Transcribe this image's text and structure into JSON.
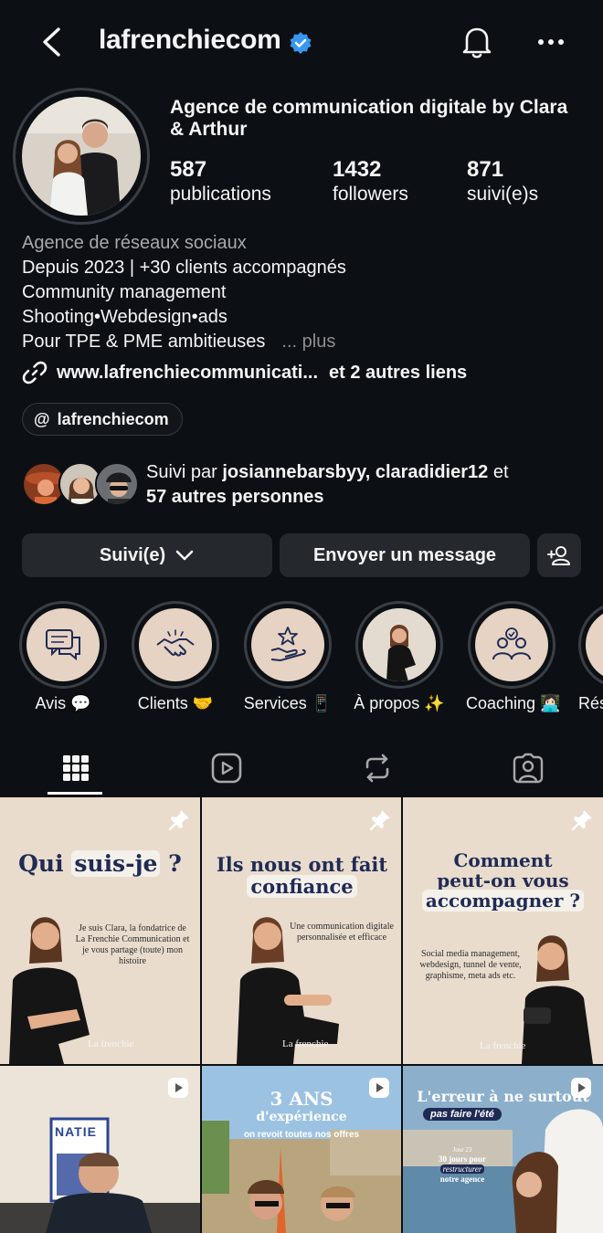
{
  "header": {
    "username": "lafrenchiecom",
    "verified": true,
    "icons": [
      "back-arrow-icon",
      "verified-badge-icon",
      "bell-icon",
      "more-dots-icon"
    ]
  },
  "profile": {
    "full_name": "Agence de communication digitale by Clara & Arthur",
    "stats": [
      {
        "value": "587",
        "label": "publications"
      },
      {
        "value": "1432",
        "label": "followers"
      },
      {
        "value": "871",
        "label": "suivi(e)s"
      }
    ],
    "bio": {
      "category": "Agence de réseaux sociaux",
      "lines": [
        "Depuis 2023 | +30 clients accompagnés",
        "Community management",
        "Shooting•Webdesign•ads",
        "Pour TPE & PME ambitieuses"
      ],
      "more": "... plus"
    },
    "link": {
      "url": "www.lafrenchiecommunicati...",
      "others": "et 2 autres liens"
    },
    "threads_handle": "lafrenchiecom",
    "followed_by": {
      "prefix": "Suivi par",
      "names": "josiannebarsbyy, claradidier12",
      "conj": "et",
      "others": "57 autres personnes"
    }
  },
  "actions": {
    "follow_label": "Suivi(e)",
    "message_label": "Envoyer un message"
  },
  "highlights": [
    {
      "label": "Avis 💬",
      "icon": "chat-bubbles-icon"
    },
    {
      "label": "Clients 🤝",
      "icon": "handshake-icon"
    },
    {
      "label": "Services 📱",
      "icon": "star-hand-icon"
    },
    {
      "label": "À propos ✨",
      "icon": "photo"
    },
    {
      "label": "Coaching 👩🏻‍💻",
      "icon": "people-icon"
    },
    {
      "label": "Rés",
      "icon": "partial"
    }
  ],
  "tabs": [
    "grid-icon",
    "reels-icon",
    "tagged-repost-icon",
    "tagged-user-icon"
  ],
  "posts": [
    {
      "title_a": "Qui ",
      "title_b": "suis-je",
      "title_c": " ?",
      "text": "Je suis Clara, la fondatrice de La Frenchie Communication et je vous partage (toute) mon histoire",
      "brand": "La frenchie",
      "pinned": true
    },
    {
      "title_a": "Ils nous ont fait",
      "title_b": "confiance",
      "text": "Une communication digitale personnalisée et efficace",
      "brand": "La frenchie",
      "pinned": true
    },
    {
      "title_a": "Comment",
      "title_b": "peut-on vous",
      "title_c": "accompagner ?",
      "text": "Social media management, webdesign, tunnel de vente, graphisme, meta ads etc.",
      "brand": "La frenchie",
      "pinned": true
    },
    {
      "poster_text": "NATIE",
      "reel": true
    },
    {
      "title_a": "3 ANS",
      "title_b": "d'expérience",
      "title_c": "on revoit toutes nos offres",
      "reel": true
    },
    {
      "title_a": "L'erreur à ne surtout",
      "title_b": "pas faire l'été",
      "title_c": "Jour 23",
      "text_a": "30 jours pour",
      "text_b": "restructurer",
      "text_c": "notre agence",
      "reel": true
    }
  ]
}
